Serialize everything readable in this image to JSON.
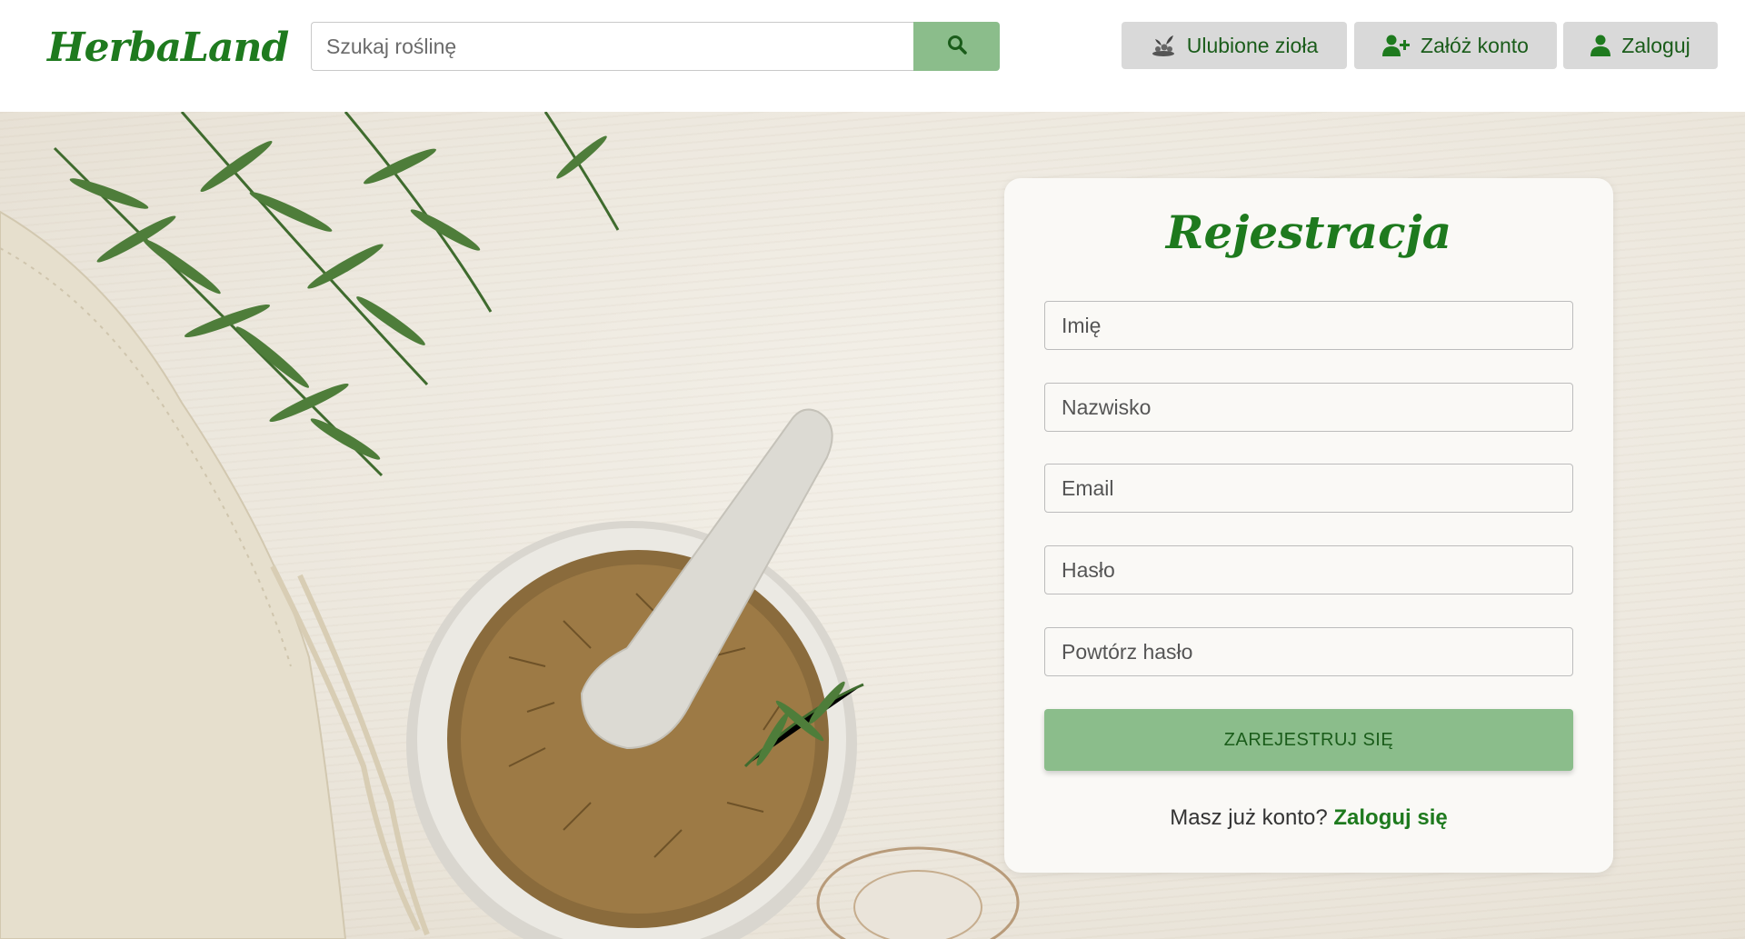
{
  "header": {
    "logo_text": "HerbaLand",
    "search": {
      "placeholder": "Szukaj roślinę",
      "value": ""
    },
    "nav": {
      "favorites_label": "Ulubione zioła",
      "register_label": "Załóż konto",
      "login_label": "Zaloguj"
    }
  },
  "icons": {
    "search": "search-icon",
    "favorites": "herb-plant-icon",
    "register": "user-plus-icon",
    "login": "user-icon"
  },
  "colors": {
    "brand": "#1e7a1e",
    "button_green": "#8bbd8b",
    "nav_button_bg": "#d9d9d9"
  },
  "form": {
    "title": "Rejestracja",
    "fields": {
      "first_name": {
        "placeholder": "Imię",
        "value": ""
      },
      "last_name": {
        "placeholder": "Nazwisko",
        "value": ""
      },
      "email": {
        "placeholder": "Email",
        "value": ""
      },
      "password": {
        "placeholder": "Hasło",
        "value": ""
      },
      "repeat_password": {
        "placeholder": "Powtórz hasło",
        "value": ""
      }
    },
    "submit_label": "ZAREJESTRUJ SIĘ",
    "footer_text": "Masz już konto?",
    "footer_link": "Zaloguj się"
  }
}
